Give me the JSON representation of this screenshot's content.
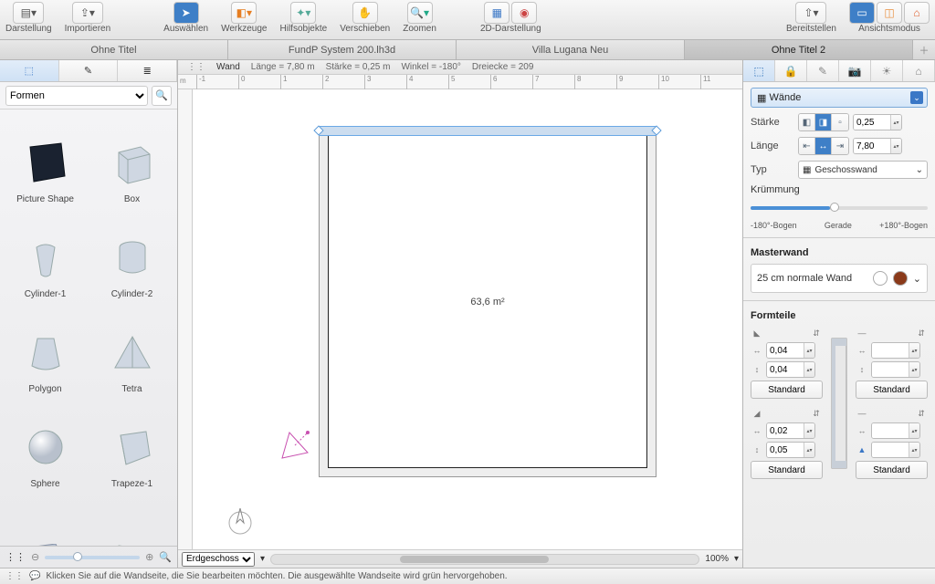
{
  "toolbar": {
    "groups": [
      {
        "label": "Darstellung",
        "icons": [
          "layout-icon",
          "chevron-down-icon"
        ]
      },
      {
        "label": "Importieren",
        "icons": [
          "import-icon",
          "chevron-down-icon"
        ]
      },
      {
        "label": "Auswählen",
        "icons": [
          "cursor-icon"
        ]
      },
      {
        "label": "Werkzeuge",
        "icons": [
          "tools-icon",
          "chevron-down-icon"
        ]
      },
      {
        "label": "Hilfsobjekte",
        "icons": [
          "helpers-icon",
          "chevron-down-icon"
        ]
      },
      {
        "label": "Verschieben",
        "icons": [
          "hand-icon"
        ]
      },
      {
        "label": "Zoomen",
        "icons": [
          "zoom-icon",
          "chevron-down-icon"
        ]
      },
      {
        "label": "2D-Darstellung",
        "icons": [
          "view2d-a-icon",
          "view2d-b-icon"
        ]
      },
      {
        "label": "Bereitstellen",
        "icons": [
          "share-icon",
          "chevron-down-icon"
        ]
      },
      {
        "label": "Ansichtsmodus",
        "icons": [
          "mode-a-icon",
          "mode-b-icon",
          "mode-c-icon"
        ]
      }
    ]
  },
  "tabs": [
    "Ohne Titel",
    "FundP System 200.lh3d",
    "Villa Lugana Neu",
    "Ohne Titel 2"
  ],
  "activeTab": 3,
  "leftPanel": {
    "category": "Formen",
    "shapes": [
      "Picture Shape",
      "Box",
      "Cylinder-1",
      "Cylinder-2",
      "Polygon",
      "Tetra",
      "Sphere",
      "Trapeze-1",
      "",
      ""
    ]
  },
  "canvas": {
    "info": {
      "obj": "Wand",
      "len_lbl": "Länge =",
      "len": "7,80 m",
      "thk_lbl": "Stärke =",
      "thk": "0,25 m",
      "ang_lbl": "Winkel =",
      "ang": "-180°",
      "tri_lbl": "Dreiecke =",
      "tri": "209"
    },
    "ruler": [
      "-1",
      "0",
      "1",
      "2",
      "3",
      "4",
      "5",
      "6",
      "7",
      "8",
      "9",
      "10",
      "11"
    ],
    "roomLabel": "63,6 m²",
    "floorSelect": "Erdgeschoss",
    "zoomPct": "100%"
  },
  "inspector": {
    "mainSelect": "Wände",
    "staerke_lbl": "Stärke",
    "staerke": "0,25",
    "laenge_lbl": "Länge",
    "laenge": "7,80",
    "typ_lbl": "Typ",
    "typ": "Geschosswand",
    "kruemmung_lbl": "Krümmung",
    "curv_labels": [
      "-180°-Bogen",
      "Gerade",
      "+180°-Bogen"
    ],
    "master_lbl": "Masterwand",
    "master_val": "25 cm normale Wand",
    "formteile_lbl": "Formteile",
    "left_vals": [
      "0,04",
      "0,04",
      "0,02",
      "0,05"
    ],
    "right_vals": [
      "",
      "",
      "",
      ""
    ],
    "standard": "Standard"
  },
  "status": "Klicken Sie auf die Wandseite, die Sie bearbeiten möchten. Die ausgewählte Wandseite wird grün hervorgehoben.",
  "colors": {
    "accent": "#3e7fc7"
  }
}
